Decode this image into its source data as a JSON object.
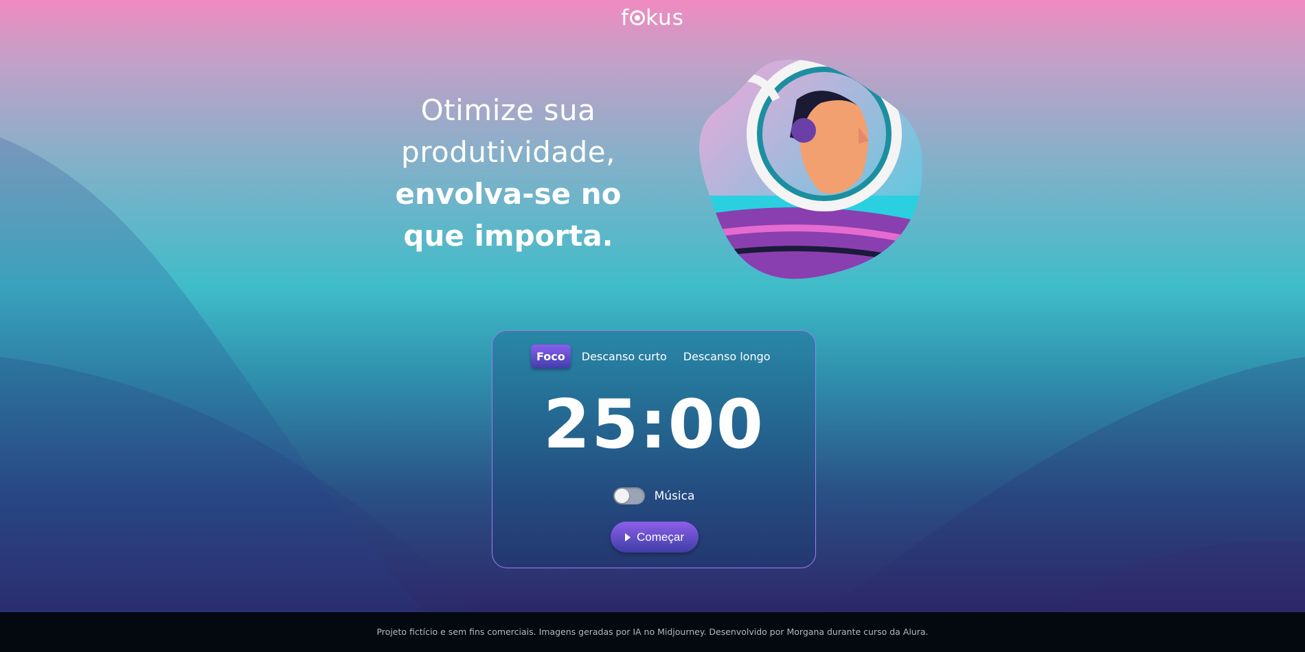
{
  "header": {
    "logo_text_pre": "f",
    "logo_text_post": "kus"
  },
  "hero": {
    "line1": "Otimize sua",
    "line2": "produtividade,",
    "line3": "envolva-se no",
    "line4": "que importa."
  },
  "tabs": [
    {
      "label": "Foco",
      "active": true
    },
    {
      "label": "Descanso curto",
      "active": false
    },
    {
      "label": "Descanso longo",
      "active": false
    }
  ],
  "timer": {
    "value": "25:00"
  },
  "music": {
    "label": "Música",
    "enabled": false
  },
  "start_button": {
    "label": "Começar",
    "icon": "play-icon"
  },
  "footer": {
    "text": "Projeto fictício e sem fins comerciais. Imagens geradas por IA no Midjourney. Desenvolvido por Morgana durante curso da Alura."
  },
  "colors": {
    "accent": "#8a5ef0",
    "footer_bg": "#03090f"
  }
}
